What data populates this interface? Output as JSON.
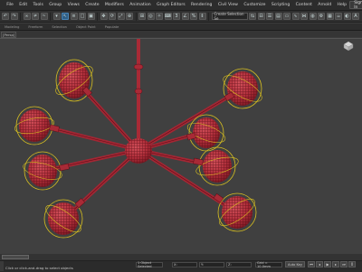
{
  "menubar": {
    "items": [
      "File",
      "Edit",
      "Tools",
      "Group",
      "Views",
      "Create",
      "Modifiers",
      "Animation",
      "Graph Editors",
      "Rendering",
      "Civil View",
      "Customize",
      "Scripting",
      "Content",
      "Arnold",
      "Help"
    ],
    "signin_label": "Sign In"
  },
  "toolbar": {
    "selection_set_placeholder": "Create Selection Se"
  },
  "ribbon": {
    "tabs": [
      "Modeling",
      "Freeform",
      "Selection",
      "Object Paint",
      "Populate"
    ]
  },
  "viewport": {
    "label": "[Persp]",
    "model": "chandelier-wireframe",
    "colors": {
      "mesh": "#b8323e",
      "wire": "#5a0d16",
      "gizmo": "#d8c020",
      "background": "#404040"
    }
  },
  "status": {
    "text": "Click or click-and-drag to select objects",
    "selection_count": "1 Object Selected",
    "x_label": "X:",
    "x_value": "",
    "y_label": "Y:",
    "y_value": "",
    "z_label": "Z:",
    "z_value": "",
    "grid_label": "Grid = 10.0mm",
    "autokey_label": "Auto Key",
    "setkey_label": "Set Key",
    "frame_value": "0"
  }
}
